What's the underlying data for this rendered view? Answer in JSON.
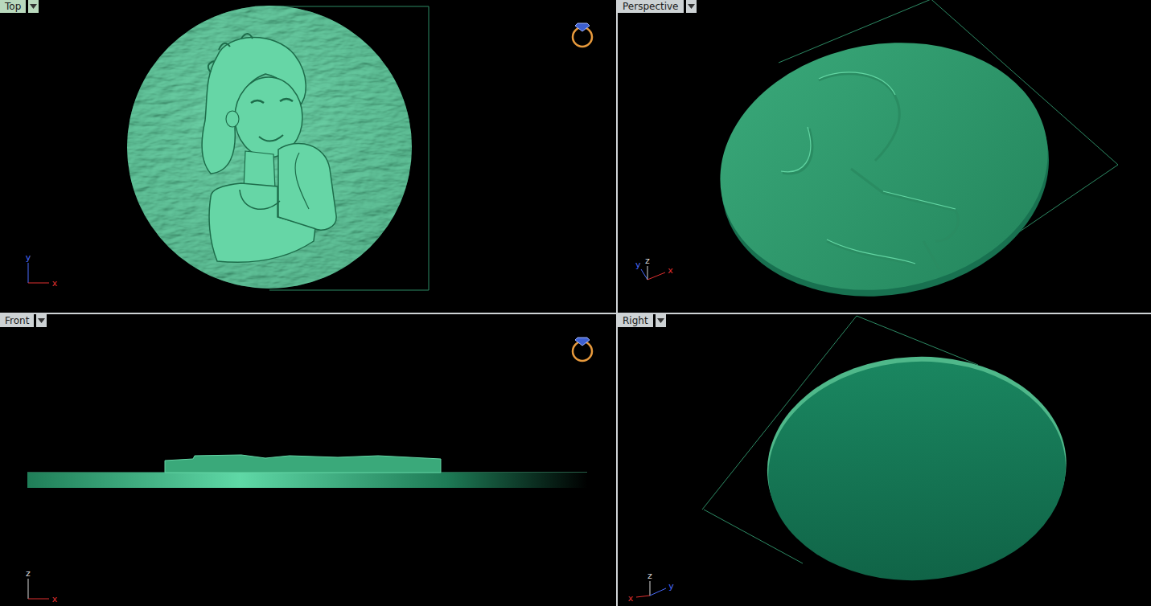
{
  "viewports": [
    {
      "label": "Top",
      "kind": "top",
      "active": true,
      "ring_icon": true,
      "axes": [
        {
          "label": "y",
          "color": "#4a6cff"
        },
        {
          "label": "x",
          "color": "#e03030"
        }
      ]
    },
    {
      "label": "Perspective",
      "kind": "perspective",
      "active": false,
      "ring_icon": false,
      "axes": [
        {
          "label": "y",
          "color": "#4a6cff"
        },
        {
          "label": "z",
          "color": "#d8d8d8"
        },
        {
          "label": "x",
          "color": "#e03030"
        }
      ]
    },
    {
      "label": "Front",
      "kind": "front",
      "active": false,
      "ring_icon": true,
      "axes": [
        {
          "label": "z",
          "color": "#d8d8d8"
        },
        {
          "label": "x",
          "color": "#e03030"
        }
      ]
    },
    {
      "label": "Right",
      "kind": "right",
      "active": false,
      "ring_icon": false,
      "axes": [
        {
          "label": "x",
          "color": "#e03030"
        },
        {
          "label": "z",
          "color": "#d8d8d8"
        },
        {
          "label": "y",
          "color": "#4a6cff"
        }
      ]
    }
  ]
}
